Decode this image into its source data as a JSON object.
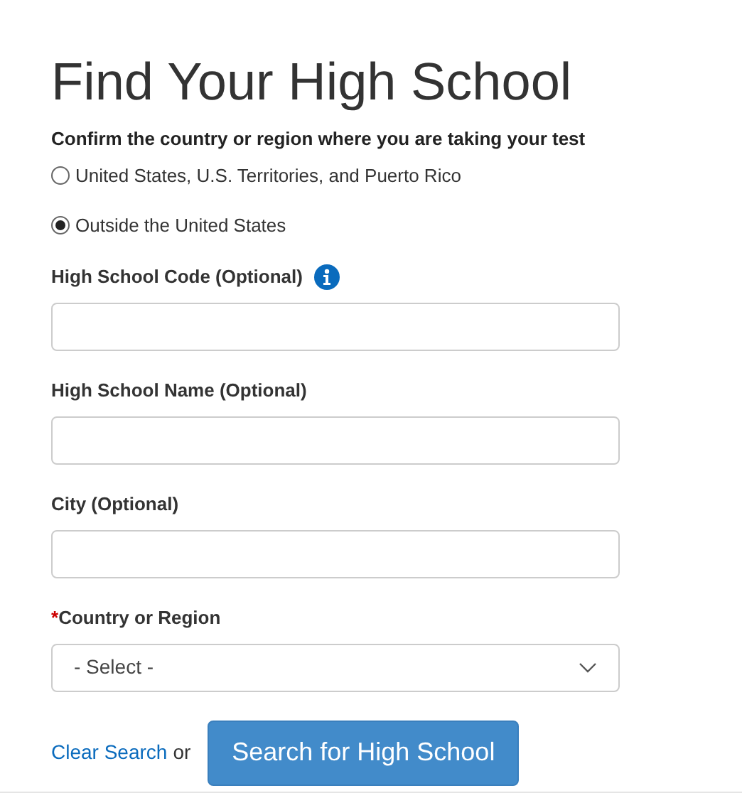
{
  "title": "Find Your High School",
  "location": {
    "prompt": "Confirm the country or region where you are taking your test",
    "options": [
      {
        "label": "United States, U.S. Territories, and Puerto Rico",
        "selected": false
      },
      {
        "label": "Outside the United States",
        "selected": true
      }
    ]
  },
  "fields": [
    {
      "kind": "text",
      "label": "High School Code (Optional)",
      "info": true
    },
    {
      "kind": "text",
      "label": "High School Name (Optional)",
      "info": false
    },
    {
      "kind": "text",
      "label": "City (Optional)",
      "info": false
    },
    {
      "kind": "select",
      "label": "Country or Region",
      "required_mark": "*",
      "value": "- Select -"
    }
  ],
  "actions": {
    "clear_link": "Clear Search",
    "separator": "or",
    "search_button": "Search for High School"
  }
}
